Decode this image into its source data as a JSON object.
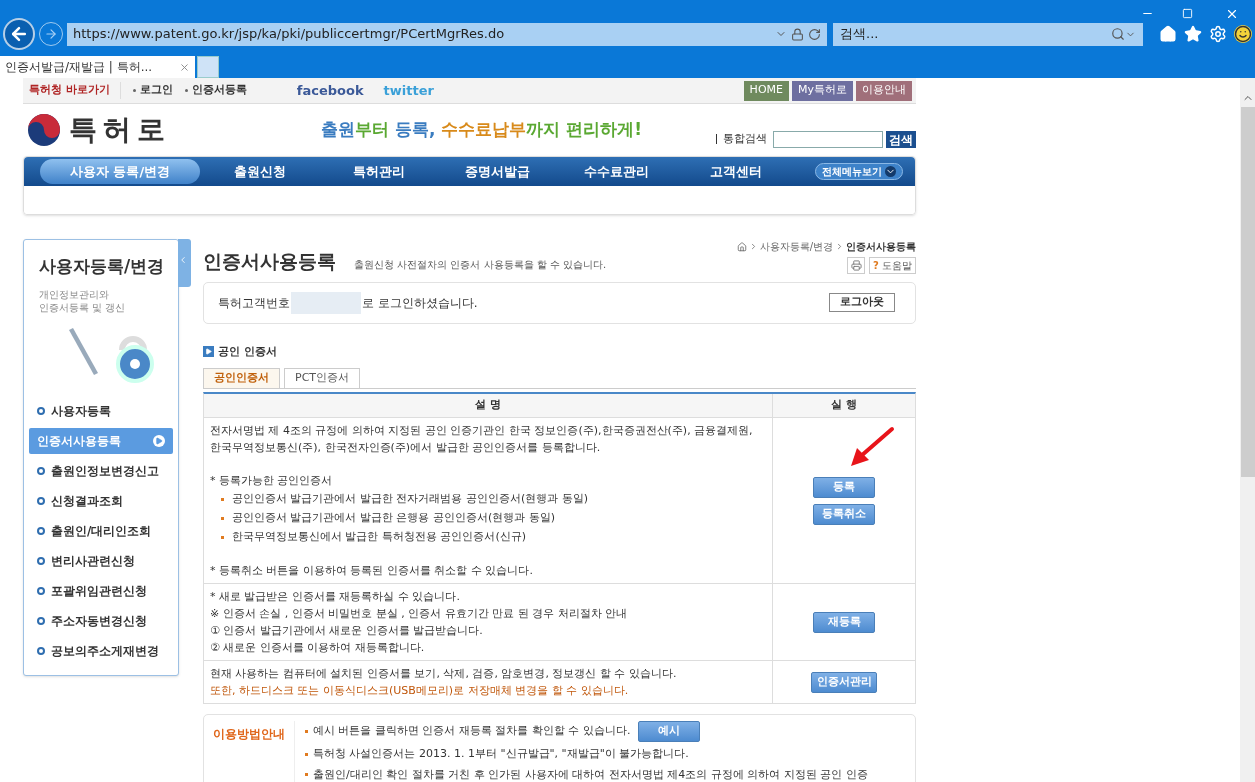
{
  "browser": {
    "url": "https://www.patent.go.kr/jsp/ka/pki/publiccertmgr/PCertMgrRes.do",
    "search_placeholder": "검색...",
    "tab_title": "인증서발급/재발급 | 특허..."
  },
  "topbar": {
    "shortcut": "특허청 바로가기",
    "links": [
      "로그인",
      "인증서등록"
    ],
    "social": [
      "facebook",
      "twitter"
    ],
    "buttons": [
      {
        "label": "HOME",
        "color": "#6f8a5e"
      },
      {
        "label": "My특허로",
        "color": "#6e6fa0"
      },
      {
        "label": "이용안내",
        "color": "#a06f7a"
      }
    ]
  },
  "header": {
    "logo": "특허로",
    "slogan": [
      {
        "text": "출원",
        "color": "#3a7cc0"
      },
      {
        "text": "부터 ",
        "color": "#5aa832"
      },
      {
        "text": "등록, ",
        "color": "#3a7cc0"
      },
      {
        "text": "수수료납부",
        "color": "#d88a1a"
      },
      {
        "text": "까지 편리하게!",
        "color": "#5aa832"
      }
    ],
    "search_label": "통합검색",
    "search_button": "검색"
  },
  "nav": {
    "items": [
      {
        "label": "사용자 등록/변경",
        "selected": true
      },
      {
        "label": "출원신청",
        "selected": false
      },
      {
        "label": "특허관리",
        "selected": false
      },
      {
        "label": "증명서발급",
        "selected": false
      },
      {
        "label": "수수료관리",
        "selected": false
      },
      {
        "label": "고객센터",
        "selected": false
      }
    ],
    "all_menu": "전체메뉴보기"
  },
  "sidebar": {
    "title": "사용자등록/변경",
    "subtitle": "개인정보관리와\n인증서등록 및 갱신",
    "items": [
      {
        "label": "사용자등록",
        "selected": false
      },
      {
        "label": "인증서사용등록",
        "selected": true
      },
      {
        "label": "출원인정보변경신고",
        "selected": false
      },
      {
        "label": "신청결과조회",
        "selected": false
      },
      {
        "label": "출원인/대리인조회",
        "selected": false
      },
      {
        "label": "변리사관련신청",
        "selected": false
      },
      {
        "label": "포괄위임관련신청",
        "selected": false
      },
      {
        "label": "주소자동변경신청",
        "selected": false
      },
      {
        "label": "공보의주소게재변경",
        "selected": false
      }
    ]
  },
  "page": {
    "title": "인증서사용등록",
    "description": "출원신청 사전절차의 인증서 사용등록을 할 수 있습니다.",
    "breadcrumb": [
      "사용자등록/변경",
      "인증서사용등록"
    ],
    "help_mark": "?",
    "help": "도움말",
    "login": {
      "prefix": "특허고객번호",
      "suffix": "로 로그인하셨습니다.",
      "logout": "로그아웃"
    },
    "section_title": "공인 인증서",
    "tabs": [
      {
        "label": "공인인증서",
        "selected": true
      },
      {
        "label": "PCT인증서",
        "selected": false
      }
    ],
    "table": {
      "columns": [
        "설 명",
        "실 행"
      ],
      "rows": [
        {
          "lines": [
            {
              "kind": "text",
              "text": "전자서명법 제 4조의 규정에 의하여 지정된 공인 인증기관인 한국 정보인증(주),한국증권전산(주), 금융결제원, 한국무역정보통신(주), 한국전자인증(주)에서 발급한 공인인증서를 등록합니다."
            },
            {
              "kind": "gap"
            },
            {
              "kind": "text",
              "text": "* 등록가능한 공인인증서"
            },
            {
              "kind": "bullet",
              "text": "공인인증서 발급기관에서 발급한 전자거래범용 공인인증서(현행과 동일)"
            },
            {
              "kind": "bullet",
              "text": "공인인증서 발급기관에서 발급한 은행용 공인인증서(현행과 동일)"
            },
            {
              "kind": "bullet",
              "text": "한국무역정보통신에서 발급한 특허청전용 공인인증서(신규)"
            },
            {
              "kind": "gap"
            },
            {
              "kind": "text",
              "text": "* 등록취소 버튼을 이용하여 등록된 인증서를 취소할 수 있습니다."
            }
          ],
          "actions": [
            "등록",
            "등록취소"
          ],
          "pointer": true
        },
        {
          "lines": [
            {
              "kind": "text",
              "text": "* 새로 발급받은 인증서를 재등록하실 수 있습니다."
            },
            {
              "kind": "text",
              "text": "※ 인증서 손실 , 인증서 비밀번호 분실 , 인증서 유효기간 만료 된 경우 처리절차 안내"
            },
            {
              "kind": "text",
              "text": "① 인증서 발급기관에서 새로운 인증서를 발급받습니다."
            },
            {
              "kind": "text",
              "text": "② 새로운 인증서를 이용하여 재등록합니다."
            }
          ],
          "actions": [
            "재등록"
          ],
          "pointer": false
        },
        {
          "lines": [
            {
              "kind": "text",
              "text": "현재 사용하는 컴퓨터에 설치된 인증서를 보기, 삭제, 검증, 암호변경, 정보갱신 할 수 있습니다."
            },
            {
              "kind": "notice",
              "text": "또한, 하드디스크 또는 이동식디스크(USB메모리)로 저장매체 변경을 할 수 있습니다."
            }
          ],
          "actions": [
            "인증서관리"
          ],
          "pointer": false
        }
      ]
    },
    "guide": {
      "title": "이용방법안내",
      "items": [
        {
          "text": "예시 버튼을 클릭하면 인증서 재등록 절차를 확인할 수 있습니다.",
          "button": "예시"
        },
        {
          "text": "특허청 사설인증서는 2013. 1. 1부터 \"신규발급\", \"재발급\"이 불가능합니다."
        },
        {
          "text": "출원인/대리인 확인 절차를 거친 후 인가된 사용자에 대하여 전자서명법 제4조의 규정에 의하여 지정된 공인 인증"
        }
      ]
    }
  }
}
